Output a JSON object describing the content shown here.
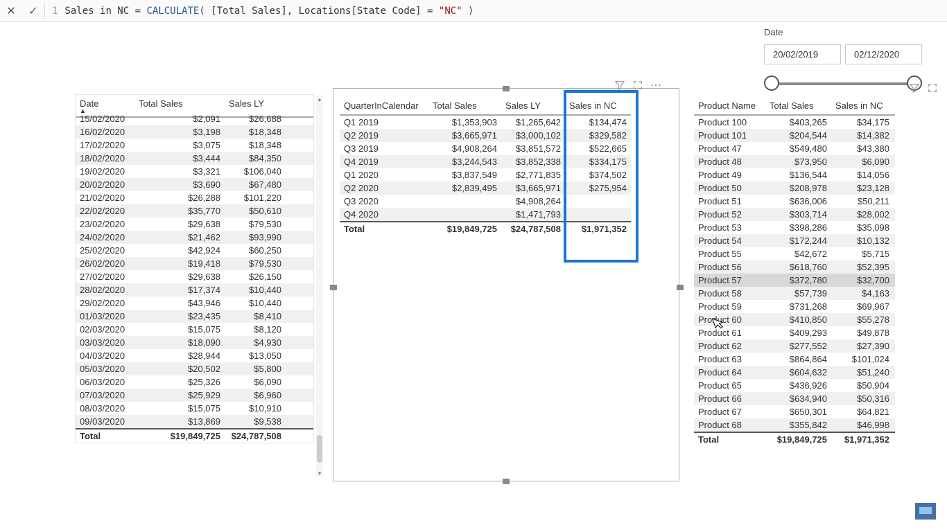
{
  "formula": {
    "line_no": "1",
    "raw": "Sales in NC = CALCULATE( [Total Sales], Locations[State Code] = \"NC\" )",
    "prefix": "Sales in NC = ",
    "fn": "CALCULATE",
    "open": "(",
    "arg1": " [Total Sales], Locations[State Code] = ",
    "str": "\"NC\"",
    "close": " )"
  },
  "date_slicer": {
    "label": "Date",
    "start": "20/02/2019",
    "end": "02/12/2020"
  },
  "table_date": {
    "headers": [
      "Date",
      "Total Sales",
      "Sales LY"
    ],
    "widths": [
      85,
      130,
      88
    ],
    "rows": [
      [
        "15/02/2020",
        "$2,091",
        "$26,688"
      ],
      [
        "16/02/2020",
        "$3,198",
        "$18,348"
      ],
      [
        "17/02/2020",
        "$3,075",
        "$18,348"
      ],
      [
        "18/02/2020",
        "$3,444",
        "$84,350"
      ],
      [
        "19/02/2020",
        "$3,321",
        "$106,040"
      ],
      [
        "20/02/2020",
        "$3,690",
        "$67,480"
      ],
      [
        "21/02/2020",
        "$26,288",
        "$101,220"
      ],
      [
        "22/02/2020",
        "$35,770",
        "$50,610"
      ],
      [
        "23/02/2020",
        "$29,638",
        "$79,530"
      ],
      [
        "24/02/2020",
        "$21,462",
        "$93,990"
      ],
      [
        "25/02/2020",
        "$42,924",
        "$60,250"
      ],
      [
        "26/02/2020",
        "$19,418",
        "$79,530"
      ],
      [
        "27/02/2020",
        "$29,638",
        "$26,150"
      ],
      [
        "28/02/2020",
        "$17,374",
        "$10,440"
      ],
      [
        "29/02/2020",
        "$43,946",
        "$10,440"
      ],
      [
        "01/03/2020",
        "$23,435",
        "$8,410"
      ],
      [
        "02/03/2020",
        "$15,075",
        "$8,120"
      ],
      [
        "03/03/2020",
        "$18,090",
        "$4,930"
      ],
      [
        "04/03/2020",
        "$28,944",
        "$13,050"
      ],
      [
        "05/03/2020",
        "$20,502",
        "$5,800"
      ],
      [
        "06/03/2020",
        "$25,326",
        "$6,090"
      ],
      [
        "07/03/2020",
        "$25,929",
        "$6,960"
      ],
      [
        "08/03/2020",
        "$15,075",
        "$10,910"
      ],
      [
        "09/03/2020",
        "$13,869",
        "$9,538"
      ]
    ],
    "total": [
      "Total",
      "$19,849,725",
      "$24,787,508"
    ]
  },
  "table_quarter": {
    "headers": [
      "QuarterInCalendar",
      "Total Sales",
      "Sales LY",
      "Sales in NC"
    ],
    "widths": [
      128,
      105,
      92,
      95
    ],
    "rows": [
      [
        "Q1 2019",
        "$1,353,903",
        "$1,265,642",
        "$134,474"
      ],
      [
        "Q2 2019",
        "$3,665,971",
        "$3,000,102",
        "$329,582"
      ],
      [
        "Q3 2019",
        "$4,908,264",
        "$3,851,572",
        "$522,665"
      ],
      [
        "Q4 2019",
        "$3,244,543",
        "$3,852,338",
        "$334,175"
      ],
      [
        "Q1 2020",
        "$3,837,549",
        "$2,771,835",
        "$374,502"
      ],
      [
        "Q2 2020",
        "$2,839,495",
        "$3,665,971",
        "$275,954"
      ],
      [
        "Q3 2020",
        "",
        "$4,908,264",
        ""
      ],
      [
        "Q4 2020",
        "",
        "$1,471,793",
        ""
      ]
    ],
    "total": [
      "Total",
      "$19,849,725",
      "$24,787,508",
      "$1,971,352"
    ]
  },
  "table_product": {
    "headers": [
      "Product Name",
      "Total Sales",
      "Sales in NC"
    ],
    "widths": [
      103,
      95,
      90
    ],
    "hover_index": 12,
    "rows": [
      [
        "Product 100",
        "$403,265",
        "$34,175"
      ],
      [
        "Product 101",
        "$204,544",
        "$14,382"
      ],
      [
        "Product 47",
        "$549,480",
        "$43,380"
      ],
      [
        "Product 48",
        "$73,950",
        "$6,090"
      ],
      [
        "Product 49",
        "$136,544",
        "$14,056"
      ],
      [
        "Product 50",
        "$208,978",
        "$23,128"
      ],
      [
        "Product 51",
        "$636,006",
        "$50,211"
      ],
      [
        "Product 52",
        "$303,714",
        "$28,002"
      ],
      [
        "Product 53",
        "$398,286",
        "$35,098"
      ],
      [
        "Product 54",
        "$172,244",
        "$10,132"
      ],
      [
        "Product 55",
        "$42,672",
        "$5,715"
      ],
      [
        "Product 56",
        "$618,760",
        "$52,395"
      ],
      [
        "Product 57",
        "$372,780",
        "$32,700"
      ],
      [
        "Product 58",
        "$57,739",
        "$4,163"
      ],
      [
        "Product 59",
        "$731,268",
        "$69,967"
      ],
      [
        "Product 60",
        "$410,850",
        "$55,278"
      ],
      [
        "Product 61",
        "$409,293",
        "$49,878"
      ],
      [
        "Product 62",
        "$277,552",
        "$27,390"
      ],
      [
        "Product 63",
        "$864,864",
        "$101,024"
      ],
      [
        "Product 64",
        "$604,632",
        "$51,240"
      ],
      [
        "Product 65",
        "$436,926",
        "$50,904"
      ],
      [
        "Product 66",
        "$634,940",
        "$50,316"
      ],
      [
        "Product 67",
        "$650,301",
        "$64,821"
      ],
      [
        "Product 68",
        "$355,842",
        "$46,998"
      ]
    ],
    "total": [
      "Total",
      "$19,849,725",
      "$1,971,352"
    ]
  }
}
